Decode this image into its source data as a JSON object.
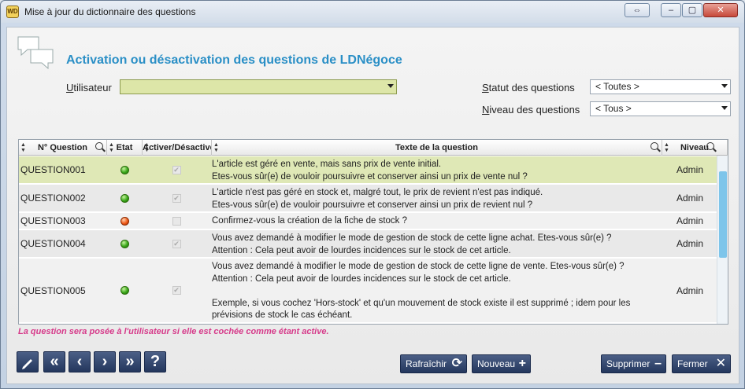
{
  "window": {
    "title": "Mise à jour du dictionnaire des questions",
    "app_icon": "WD"
  },
  "header": {
    "title": "Activation ou désactivation des questions de LDNégoce"
  },
  "filters": {
    "user_label_first": "U",
    "user_label_rest": "tilisateur",
    "user_value": "",
    "status_label_first": "S",
    "status_label_rest": "tatut  des questions",
    "status_value": "< Toutes >",
    "level_label_first": "N",
    "level_label_rest": "iveau des questions",
    "level_value": "< Tous >"
  },
  "grid": {
    "columns": [
      "N° Question",
      "Etat",
      "Activer/Désactiver",
      "Texte de la question",
      "Niveau"
    ],
    "rows": [
      {
        "id": "QUESTION001",
        "state": "green",
        "active": true,
        "text": [
          "L'article est géré en vente, mais sans prix de vente initial.",
          "Etes-vous sûr(e) de vouloir poursuivre et conserver ainsi un prix de vente nul ?"
        ],
        "level": "Admin"
      },
      {
        "id": "QUESTION002",
        "state": "green",
        "active": true,
        "text": [
          "L'article n'est pas géré en stock et, malgré tout, le prix de revient n'est pas indiqué.",
          "Etes-vous sûr(e) de vouloir poursuivre et conserver ainsi un prix de revient nul ?"
        ],
        "level": "Admin"
      },
      {
        "id": "QUESTION003",
        "state": "red",
        "active": false,
        "text": [
          "Confirmez-vous la création de la fiche de stock  ?"
        ],
        "level": "Admin"
      },
      {
        "id": "QUESTION004",
        "state": "green",
        "active": true,
        "text": [
          "Vous avez demandé à modifier le mode de gestion de stock de cette ligne achat. Etes-vous sûr(e) ?",
          "Attention : Cela peut avoir de lourdes incidences sur le stock de cet article."
        ],
        "level": "Admin"
      },
      {
        "id": "QUESTION005",
        "state": "green",
        "active": true,
        "text": [
          "Vous avez demandé à modifier le mode de gestion de stock de cette ligne de vente. Etes-vous sûr(e) ?",
          "Attention : Cela peut avoir de lourdes incidences sur le stock de cet article.",
          "",
          "Exemple, si vous cochez 'Hors-stock' et qu'un mouvement de stock existe il est supprimé ; idem pour les",
          "prévisions de stock le cas échéant."
        ],
        "level": "Admin"
      }
    ]
  },
  "hint": "La question sera posée à l'utilisateur si elle est cochée comme étant active.",
  "buttons": {
    "refresh": "Rafraîchir",
    "new": "Nouveau",
    "delete": "Supprimer",
    "close": "Fermer"
  },
  "nav": {
    "edit_icon": "pencil-icon",
    "first_icon": "double-chevron-left-icon",
    "prev_icon": "chevron-left-icon",
    "next_icon": "chevron-right-icon",
    "last_icon": "double-chevron-right-icon",
    "help": "?"
  },
  "colors": {
    "heading": "#2a8fc6",
    "hint": "#d63a8a",
    "selected_row": "#dfe8b6",
    "button": "#2f4470"
  }
}
